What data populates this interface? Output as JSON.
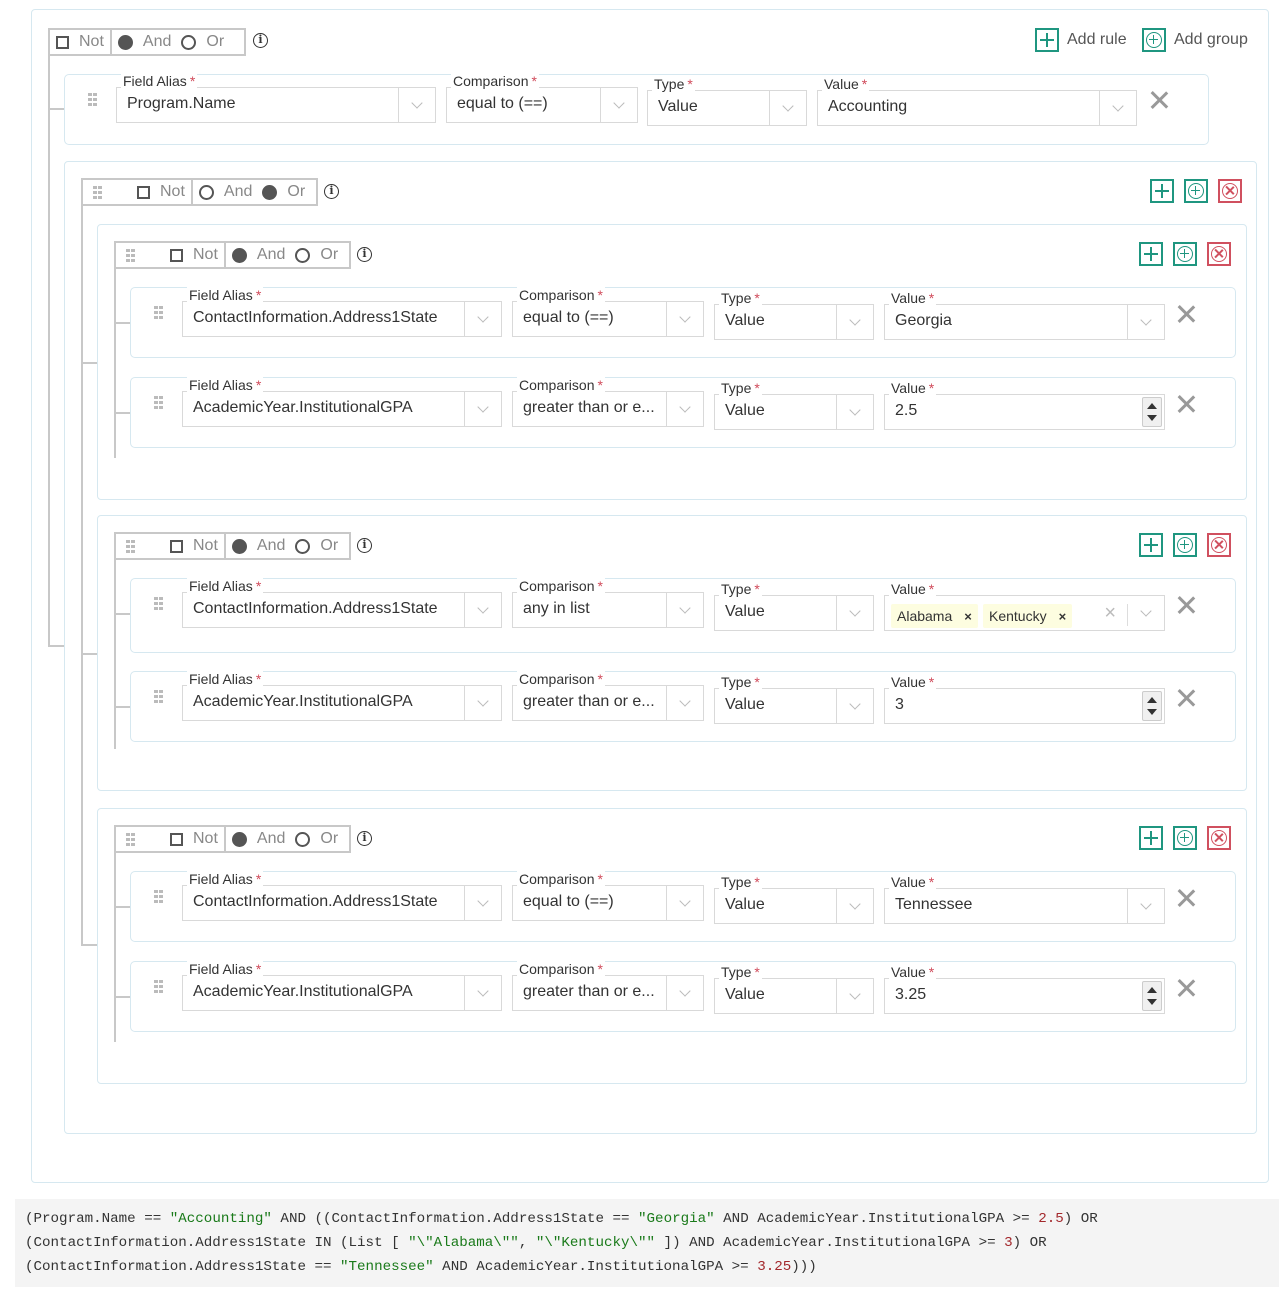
{
  "colors": {
    "accent": "#1f9680",
    "danger": "#d0505f",
    "required": "#d04a5a",
    "string": "#1a7a1a",
    "number": "#a3282c"
  },
  "combinator_labels": {
    "not": "Not",
    "and": "And",
    "or": "Or"
  },
  "root": {
    "not": false,
    "combinator": "and",
    "add_rule_label": "Add rule",
    "add_group_label": "Add group",
    "rule": {
      "field_label": "Field Alias",
      "field": "Program.Name",
      "comparison_label": "Comparison",
      "comparison": "equal to (==)",
      "type_label": "Type",
      "type": "Value",
      "value_label": "Value",
      "value": "Accounting"
    }
  },
  "group_or": {
    "not": false,
    "combinator": "or",
    "subgroups": [
      {
        "not": false,
        "combinator": "and",
        "rules": [
          {
            "field_label": "Field Alias",
            "field": "ContactInformation.Address1State",
            "comparison_label": "Comparison",
            "comparison": "equal to (==)",
            "type_label": "Type",
            "type": "Value",
            "value_label": "Value",
            "value": "Georgia"
          },
          {
            "field_label": "Field Alias",
            "field": "AcademicYear.InstitutionalGPA",
            "comparison_label": "Comparison",
            "comparison": "greater than or e...",
            "type_label": "Type",
            "type": "Value",
            "value_label": "Value",
            "value": "2.5"
          }
        ]
      },
      {
        "not": false,
        "combinator": "and",
        "rules": [
          {
            "field_label": "Field Alias",
            "field": "ContactInformation.Address1State",
            "comparison_label": "Comparison",
            "comparison": "any in list",
            "type_label": "Type",
            "type": "Value",
            "value_label": "Value",
            "tags": [
              "Alabama",
              "Kentucky"
            ]
          },
          {
            "field_label": "Field Alias",
            "field": "AcademicYear.InstitutionalGPA",
            "comparison_label": "Comparison",
            "comparison": "greater than or e...",
            "type_label": "Type",
            "type": "Value",
            "value_label": "Value",
            "value": "3"
          }
        ]
      },
      {
        "not": false,
        "combinator": "and",
        "rules": [
          {
            "field_label": "Field Alias",
            "field": "ContactInformation.Address1State",
            "comparison_label": "Comparison",
            "comparison": "equal to (==)",
            "type_label": "Type",
            "type": "Value",
            "value_label": "Value",
            "value": "Tennessee"
          },
          {
            "field_label": "Field Alias",
            "field": "AcademicYear.InstitutionalGPA",
            "comparison_label": "Comparison",
            "comparison": "greater than or e...",
            "type_label": "Type",
            "type": "Value",
            "value_label": "Value",
            "value": "3.25"
          }
        ]
      }
    ]
  },
  "query_output": [
    [
      {
        "t": "(Program.Name == "
      },
      {
        "t": "\"Accounting\"",
        "c": "str"
      },
      {
        "t": " AND ((ContactInformation.Address1State == "
      },
      {
        "t": "\"Georgia\"",
        "c": "str"
      },
      {
        "t": " AND AcademicYear.InstitutionalGPA >= "
      },
      {
        "t": "2.5",
        "c": "num"
      },
      {
        "t": ") OR"
      }
    ],
    [
      {
        "t": "(ContactInformation.Address1State IN (List [ "
      },
      {
        "t": "\"\\\"Alabama\\\"\"",
        "c": "str"
      },
      {
        "t": ", "
      },
      {
        "t": "\"\\\"Kentucky\\\"\"",
        "c": "str"
      },
      {
        "t": " ]) AND AcademicYear.InstitutionalGPA >= "
      },
      {
        "t": "3",
        "c": "num"
      },
      {
        "t": ") OR"
      }
    ],
    [
      {
        "t": "(ContactInformation.Address1State == "
      },
      {
        "t": "\"Tennessee\"",
        "c": "str"
      },
      {
        "t": " AND AcademicYear.InstitutionalGPA >= "
      },
      {
        "t": "3.25",
        "c": "num"
      },
      {
        "t": ")))"
      }
    ]
  ]
}
